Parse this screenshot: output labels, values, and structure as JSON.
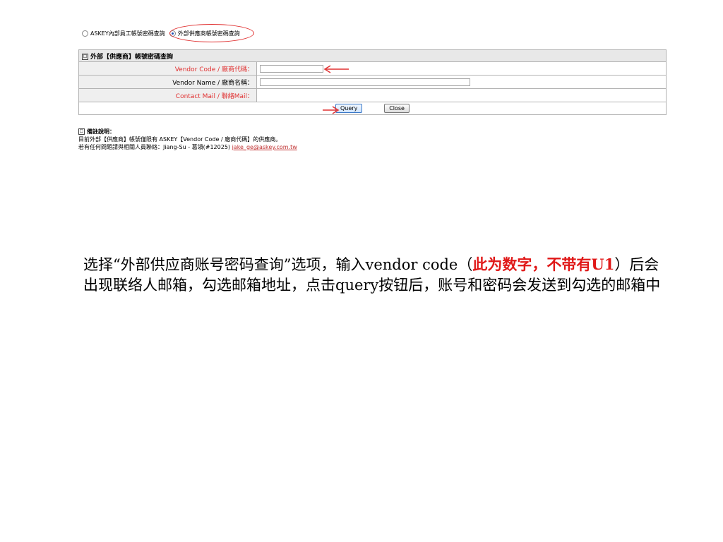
{
  "login_type": {
    "options": [
      {
        "label": "ASKEY內部員工帳號密碼查詢",
        "selected": false
      },
      {
        "label": "外部供應商帳號密碼查詢",
        "selected": true
      }
    ]
  },
  "form": {
    "header": "外部【供應商】帳號密碼查詢",
    "fields": [
      {
        "label": "Vendor Code / 廠商代碼：",
        "value": "",
        "highlight": true
      },
      {
        "label": "Vendor Name / 廠商名稱：",
        "value": "",
        "highlight": false
      },
      {
        "label": "Contact Mail / 聯絡Mail：",
        "value": "",
        "highlight": true
      }
    ],
    "buttons": {
      "query": "Query",
      "close": "Close"
    }
  },
  "notes": {
    "title": "備註說明：",
    "line1": "目前外部【供應商】帳號僅限有 ASKEY【Vendor Code / 廠商代碼】的供應商。",
    "line2_prefix": "若有任何問題請與相關人員聯絡：Jiang-Su - 葛領(#12025) ",
    "contact_email": "jake_ge@askey.com.tw"
  },
  "instruction": {
    "part1": "选择“外部供应商账号密码查询”选项，输入vendor code（",
    "part2_red": "此为数字，不带有U1",
    "part3": "）后会出现联络人邮箱，勾选邮箱地址，点击query按钮后，账号和密码会发送到勾选的邮箱中"
  },
  "colors": {
    "annotation_red": "#e03030",
    "accent_blue": "#1a4fb5"
  }
}
